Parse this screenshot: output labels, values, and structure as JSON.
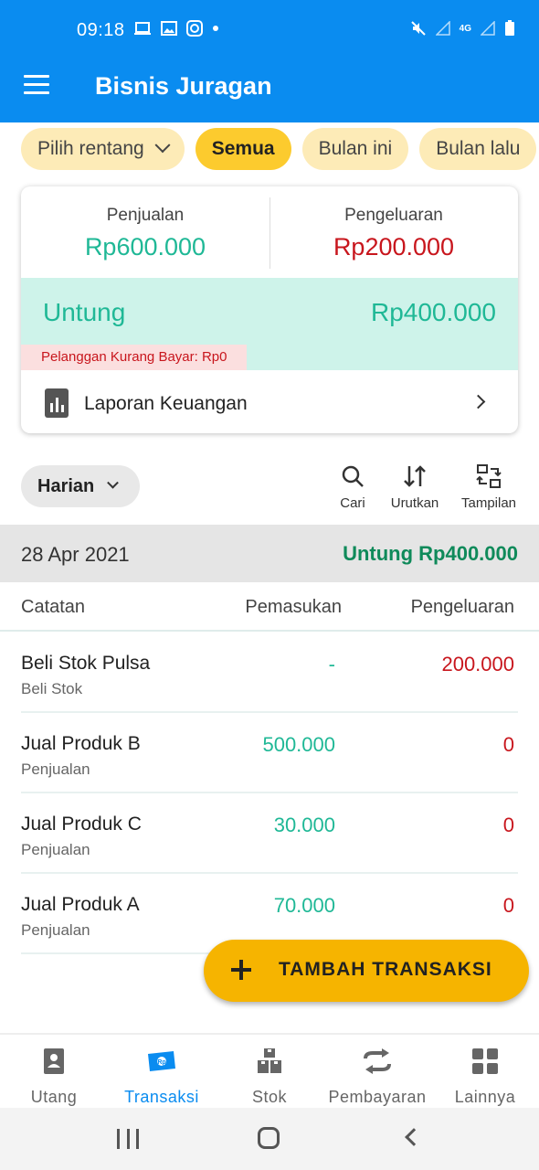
{
  "status": {
    "time": "09:18",
    "network": "4G"
  },
  "app": {
    "title": "Bisnis Juragan"
  },
  "filters": [
    "Pilih rentang",
    "Semua",
    "Bulan ini",
    "Bulan lalu"
  ],
  "summary": {
    "sales_label": "Penjualan",
    "sales_value": "Rp600.000",
    "expense_label": "Pengeluaran",
    "expense_value": "Rp200.000",
    "profit_label": "Untung",
    "profit_value": "Rp400.000",
    "debt_note": "Pelanggan Kurang Bayar: Rp0",
    "report_label": "Laporan Keuangan"
  },
  "toolbar": {
    "period": "Harian",
    "search": "Cari",
    "sort": "Urutkan",
    "view": "Tampilan"
  },
  "day": {
    "date": "28 Apr 2021",
    "profit": "Untung Rp400.000"
  },
  "table": {
    "headers": [
      "Catatan",
      "Pemasukan",
      "Pengeluaran"
    ],
    "rows": [
      {
        "name": "Beli Stok Pulsa",
        "category": "Beli Stok",
        "income": "-",
        "expense": "200.000"
      },
      {
        "name": "Jual Produk B",
        "category": "Penjualan",
        "income": "500.000",
        "expense": "0"
      },
      {
        "name": "Jual Produk C",
        "category": "Penjualan",
        "income": "30.000",
        "expense": "0"
      },
      {
        "name": "Jual Produk A",
        "category": "Penjualan",
        "income": "70.000",
        "expense": "0"
      }
    ]
  },
  "fab": {
    "label": "TAMBAH TRANSAKSI"
  },
  "bottom_nav": [
    {
      "label": "Utang",
      "icon": "contact-book-icon"
    },
    {
      "label": "Transaksi",
      "icon": "money-note-icon"
    },
    {
      "label": "Stok",
      "icon": "boxes-icon"
    },
    {
      "label": "Pembayaran",
      "icon": "swap-arrows-icon"
    },
    {
      "label": "Lainnya",
      "icon": "grid-icon"
    }
  ],
  "colors": {
    "primary": "#0a8cf0",
    "income": "#1fb896",
    "expense": "#c8161d",
    "accent": "#f6b400"
  }
}
